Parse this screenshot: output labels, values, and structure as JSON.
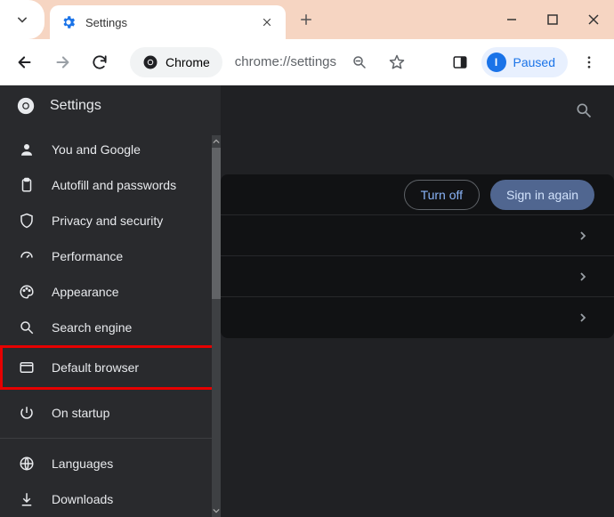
{
  "window": {
    "tab_title": "Settings"
  },
  "toolbar": {
    "chrome_badge": "Chrome",
    "url": "chrome://settings",
    "paused_label": "Paused",
    "avatar_letter": "I"
  },
  "sidebar": {
    "title": "Settings",
    "items": [
      {
        "label": "You and Google"
      },
      {
        "label": "Autofill and passwords"
      },
      {
        "label": "Privacy and security"
      },
      {
        "label": "Performance"
      },
      {
        "label": "Appearance"
      },
      {
        "label": "Search engine"
      },
      {
        "label": "Default browser"
      },
      {
        "label": "On startup"
      }
    ],
    "secondary": [
      {
        "label": "Languages"
      },
      {
        "label": "Downloads"
      }
    ]
  },
  "main": {
    "turn_off": "Turn off",
    "sign_in_again": "Sign in again"
  }
}
